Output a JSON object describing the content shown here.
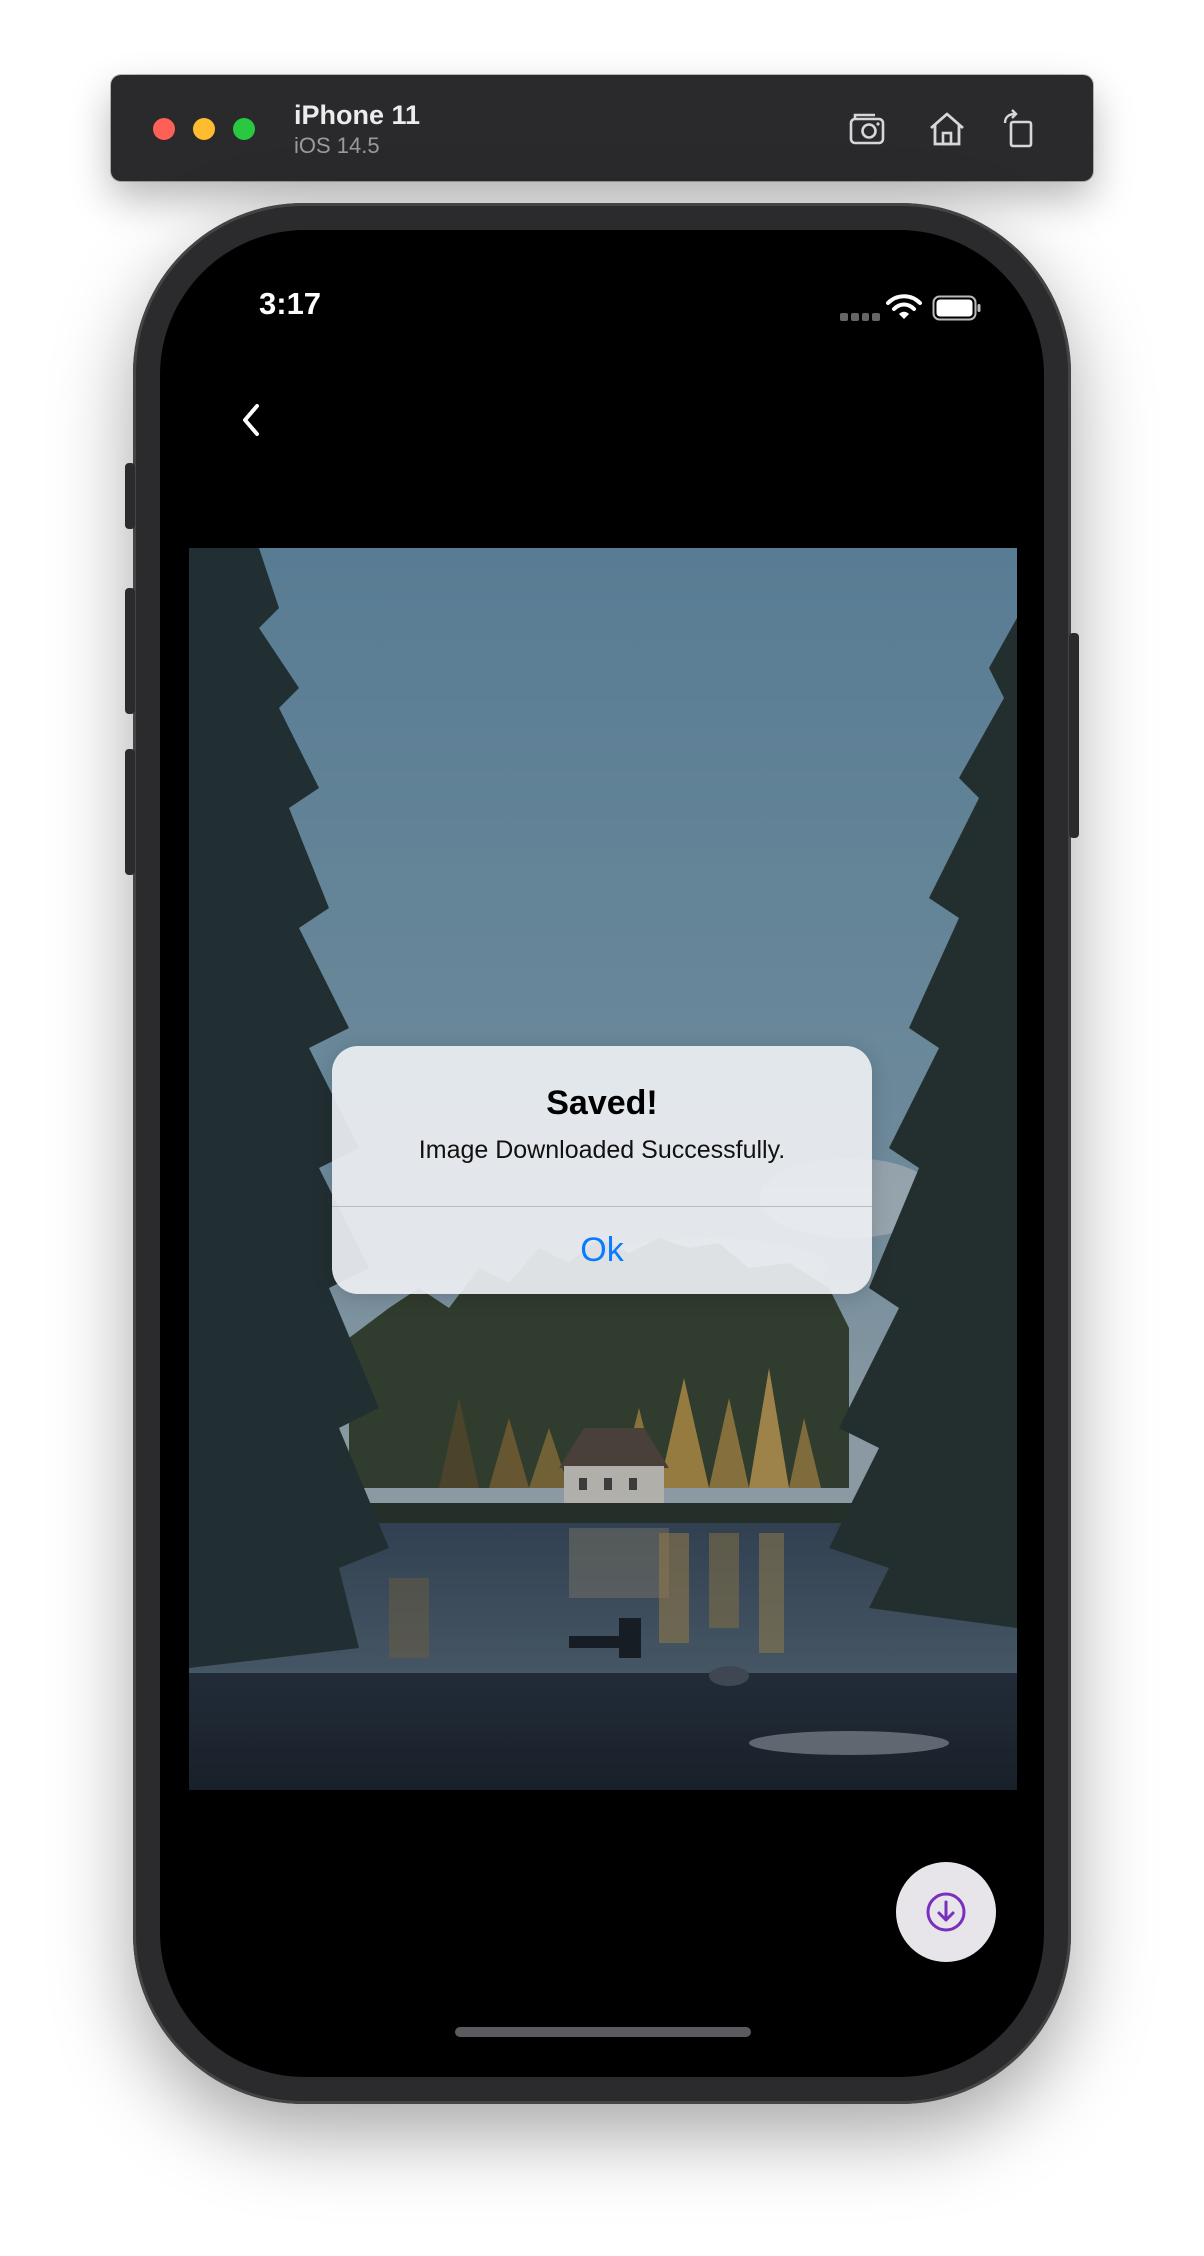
{
  "simulator": {
    "device_name": "iPhone 11",
    "os_version": "iOS 14.5",
    "buttons": {
      "screenshot": "camera-icon",
      "home": "home-icon",
      "rotate": "rotate-icon"
    }
  },
  "status_bar": {
    "time": "3:17"
  },
  "alert": {
    "title": "Saved!",
    "message": "Image Downloaded Successfully.",
    "ok_label": "Ok"
  },
  "colors": {
    "accent_blue": "#0a7aff",
    "fab_icon": "#7a2fbe",
    "fab_background": "#e7e5ea"
  }
}
